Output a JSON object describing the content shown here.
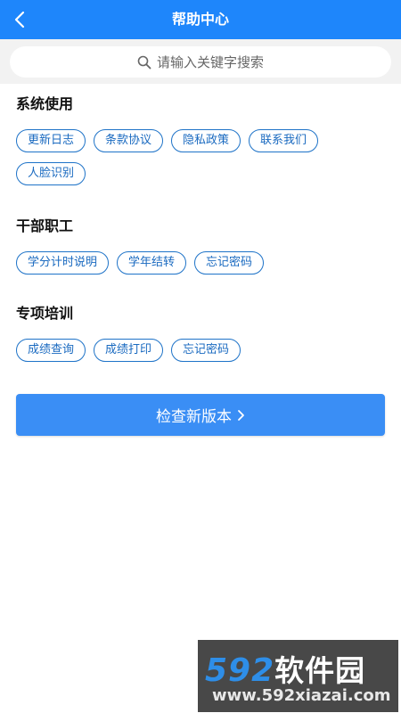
{
  "header": {
    "title": "帮助中心",
    "back_icon": "chevron-left-icon"
  },
  "search": {
    "placeholder": "请输入关键字搜索",
    "icon": "search-icon"
  },
  "sections": [
    {
      "title": "系统使用",
      "tags": [
        "更新日志",
        "条款协议",
        "隐私政策",
        "联系我们",
        "人脸识别"
      ]
    },
    {
      "title": "干部职工",
      "tags": [
        "学分计时说明",
        "学年结转",
        "忘记密码"
      ]
    },
    {
      "title": "专项培训",
      "tags": [
        "成绩查询",
        "成绩打印",
        "忘记密码"
      ]
    }
  ],
  "check_button": {
    "label": "检查新版本"
  },
  "watermark": {
    "logo_num": "592",
    "logo_text": "软件园",
    "url": "www.592xiazai.com"
  },
  "colors": {
    "primary": "#1e86fb",
    "tag_border": "#1e73c8",
    "button": "#3a8ef5"
  }
}
